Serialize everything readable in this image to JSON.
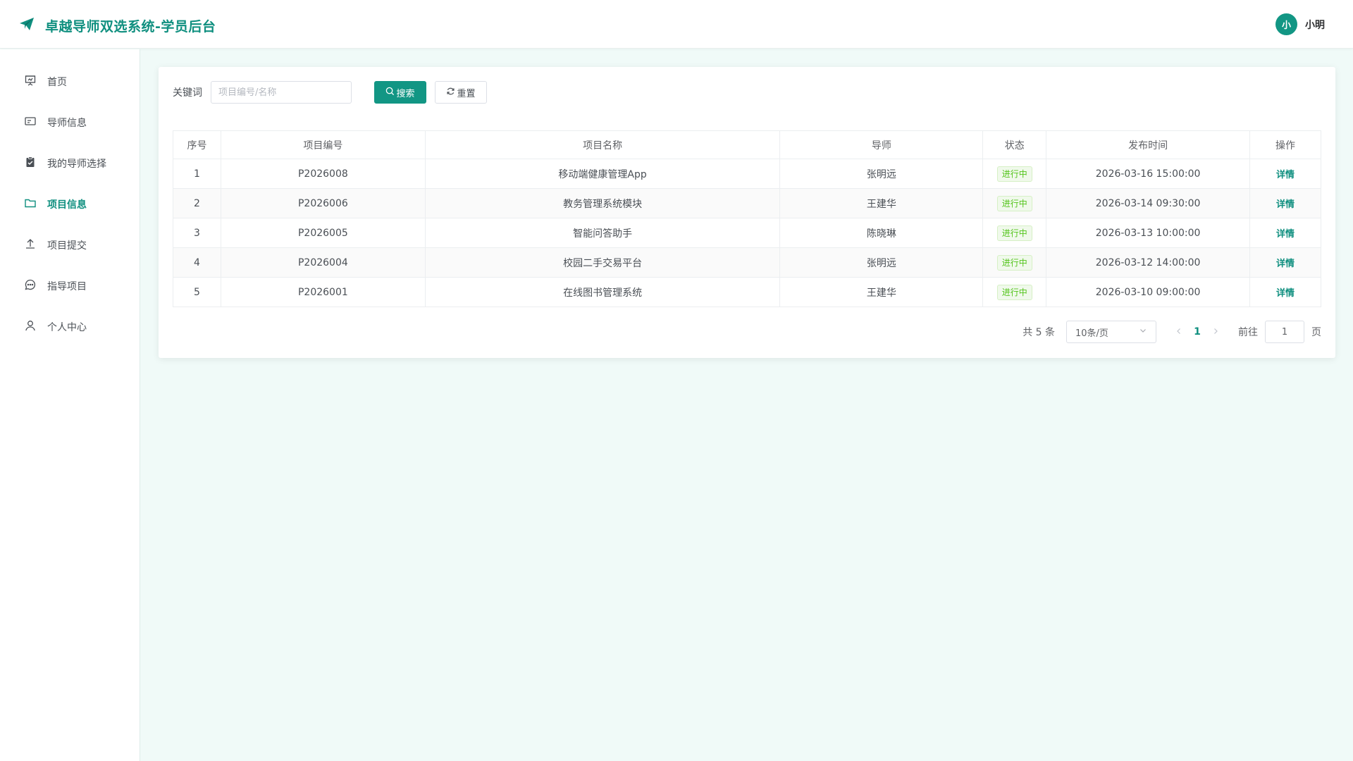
{
  "header": {
    "title": "卓越导师双选系统-学员后台",
    "avatar_text": "小",
    "username": "小明"
  },
  "sidebar": {
    "items": [
      {
        "label": "首页",
        "icon": "presentation-icon"
      },
      {
        "label": "导师信息",
        "icon": "id-card-icon"
      },
      {
        "label": "我的导师选择",
        "icon": "clipboard-check-icon"
      },
      {
        "label": "项目信息",
        "icon": "folder-icon",
        "active": true
      },
      {
        "label": "项目提交",
        "icon": "upload-icon"
      },
      {
        "label": "指导项目",
        "icon": "chat-bubble-icon"
      },
      {
        "label": "个人中心",
        "icon": "user-icon"
      }
    ]
  },
  "search": {
    "label": "关键词",
    "placeholder": "项目编号/名称",
    "value": "",
    "search_button": "搜索",
    "reset_button": "重置"
  },
  "table": {
    "columns": [
      "序号",
      "项目编号",
      "项目名称",
      "导师",
      "状态",
      "发布时间",
      "操作"
    ],
    "rows": [
      {
        "index": "1",
        "code": "P2026008",
        "name": "移动端健康管理App",
        "mentor": "张明远",
        "status": "进行中",
        "time": "2026-03-16 15:00:00",
        "action": "详情"
      },
      {
        "index": "2",
        "code": "P2026006",
        "name": "教务管理系统模块",
        "mentor": "王建华",
        "status": "进行中",
        "time": "2026-03-14 09:30:00",
        "action": "详情"
      },
      {
        "index": "3",
        "code": "P2026005",
        "name": "智能问答助手",
        "mentor": "陈晓琳",
        "status": "进行中",
        "time": "2026-03-13 10:00:00",
        "action": "详情"
      },
      {
        "index": "4",
        "code": "P2026004",
        "name": "校园二手交易平台",
        "mentor": "张明远",
        "status": "进行中",
        "time": "2026-03-12 14:00:00",
        "action": "详情"
      },
      {
        "index": "5",
        "code": "P2026001",
        "name": "在线图书管理系统",
        "mentor": "王建华",
        "status": "进行中",
        "time": "2026-03-10 09:00:00",
        "action": "详情"
      }
    ]
  },
  "pagination": {
    "total_text": "共 5 条",
    "page_size": "10条/页",
    "current_page": "1",
    "goto_label": "前往",
    "goto_value": "1",
    "page_suffix": "页"
  },
  "colors": {
    "accent": "#129684",
    "background": "#f0faf8",
    "status_green": "#52c41a"
  }
}
